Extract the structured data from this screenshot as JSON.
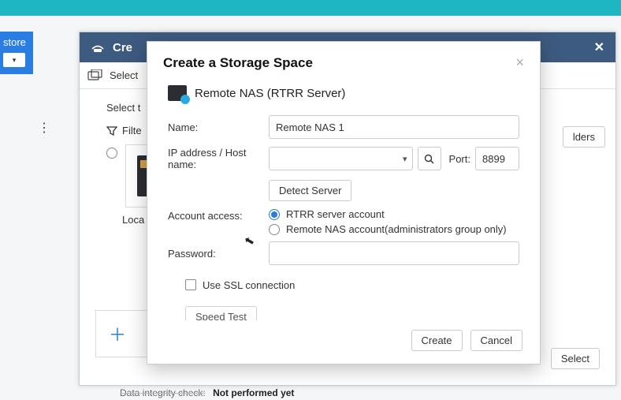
{
  "sidebar": {
    "label": "store"
  },
  "base_window": {
    "title_prefix": "Cre",
    "toolbar_label": "Select",
    "body_heading": "Select t",
    "filter_label": "Filte",
    "card_caption": "Loca",
    "lders_button": "lders",
    "select_button": "Select",
    "integrity_label": "Data integrity check:",
    "integrity_value": "Not performed yet"
  },
  "modal": {
    "title": "Create a Storage Space",
    "subtitle": "Remote NAS (RTRR Server)",
    "name_label": "Name:",
    "name_value": "Remote NAS 1",
    "ip_label": "IP address / Host name:",
    "port_label": "Port:",
    "port_value": "8899",
    "detect_button": "Detect Server",
    "account_label": "Account access:",
    "radio_rtrr": "RTRR server account",
    "radio_remote": "Remote NAS account(administrators group only)",
    "password_label": "Password:",
    "ssl_label": "Use SSL connection",
    "speed_button": "Speed Test",
    "create_button": "Create",
    "cancel_button": "Cancel"
  }
}
